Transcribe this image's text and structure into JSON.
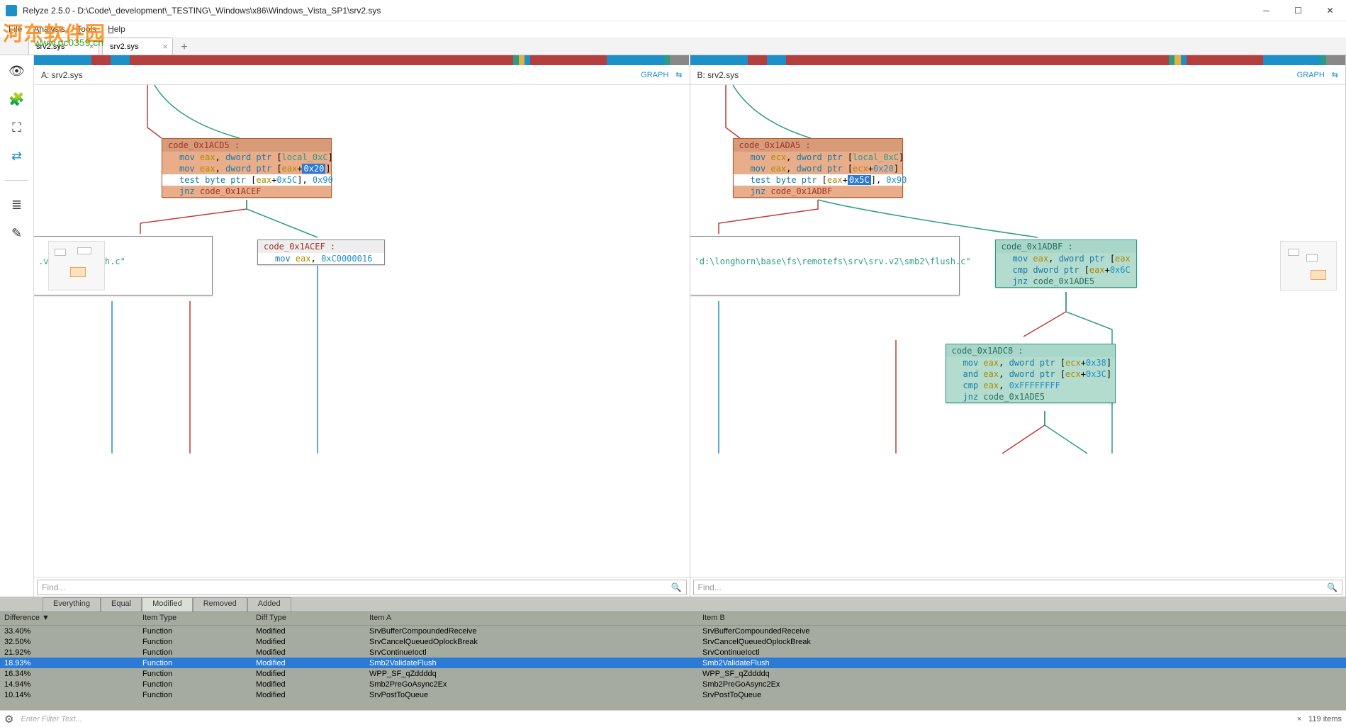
{
  "window": {
    "title": "Relyze 2.5.0 - D:\\Code\\_development\\_TESTING\\_Windows\\x86\\Windows_Vista_SP1\\srv2.sys"
  },
  "watermark": {
    "text": "河东软件园",
    "url": "www.pc0359.cn"
  },
  "menu": {
    "file": "File",
    "analysis": "Analysis",
    "tools": "Tools",
    "help": "Help"
  },
  "file_tabs": {
    "t0": "srv2.sys",
    "t1": "srv2.sys",
    "add": "+"
  },
  "rail": {
    "eye": "eye-icon",
    "puzzle": "puzzle-icon",
    "hierarchy": "hierarchy-icon",
    "shuffle": "shuffle-icon",
    "stack": "stack-icon",
    "edit": "edit-icon"
  },
  "paneA": {
    "label": "A: srv2.sys",
    "view": "GRAPH",
    "find_placeholder": "Find...",
    "node1": {
      "head": "code_0x1ACD5 :",
      "l1a": "mov",
      "l1b": "eax",
      "l1c": "dword ptr",
      "l1d": "local_0xC",
      "l2a": "mov",
      "l2b": "eax",
      "l2c": "dword ptr",
      "l2d": "eax",
      "l2e": "0x20",
      "l3a": "test",
      "l3b": "byte ptr",
      "l3c": "eax",
      "l3d": "0x5C",
      "l3e": "0x90",
      "l4a": "jnz",
      "l4b": "code_0x1ACEF"
    },
    "node2": {
      "head": "code_0x1ACEF :",
      "l1a": "mov",
      "l1b": "eax",
      "l1c": "0xC0000016"
    },
    "node3": {
      "text": ".v2\\smb2\\flush.c\""
    }
  },
  "paneB": {
    "label": "B: srv2.sys",
    "view": "GRAPH",
    "find_placeholder": "Find...",
    "node1": {
      "head": "code_0x1ADA5 :",
      "l1a": "mov",
      "l1b": "ecx",
      "l1c": "dword ptr",
      "l1d": "local_0xC",
      "l2a": "mov",
      "l2b": "eax",
      "l2c": "dword ptr",
      "l2d": "ecx",
      "l2e": "0x20",
      "l3a": "test",
      "l3b": "byte ptr",
      "l3c": "eax",
      "l3d": "0x5C",
      "l3e": "0x90",
      "l4a": "jnz",
      "l4b": "code_0x1ADBF"
    },
    "node2": {
      "head": "code_0x1ADBF :",
      "l1a": "mov",
      "l1b": "eax",
      "l1c": "dword ptr",
      "l1d": "eax",
      "l2a": "cmp",
      "l2b": "dword ptr",
      "l2c": "eax",
      "l2d": "0x6C",
      "l3a": "jnz",
      "l3b": "code_0x1ADE5"
    },
    "node3": {
      "head": "code_0x1ADC8 :",
      "l1a": "mov",
      "l1b": "eax",
      "l1c": "dword ptr",
      "l1d": "ecx",
      "l1e": "0x38",
      "l2a": "and",
      "l2b": "eax",
      "l2c": "dword ptr",
      "l2d": "ecx",
      "l2e": "0x3C",
      "l3a": "cmp",
      "l3b": "eax",
      "l3c": "0xFFFFFFFF",
      "l4a": "jnz",
      "l4b": "code_0x1ADE5"
    },
    "node4": {
      "text": "'d:\\longhorn\\base\\fs\\remotefs\\srv\\srv.v2\\smb2\\flush.c\""
    }
  },
  "diff": {
    "subtabs": {
      "everything": "Everything",
      "equal": "Equal",
      "modified": "Modified",
      "removed": "Removed",
      "added": "Added"
    },
    "headers": {
      "difference": "Difference ▼",
      "itemtype": "Item Type",
      "difftype": "Diff Type",
      "itema": "Item A",
      "itemb": "Item B"
    },
    "rows": [
      {
        "d": "33.40%",
        "t": "Function",
        "dt": "Modified",
        "a": "SrvBufferCompoundedReceive",
        "b": "SrvBufferCompoundedReceive"
      },
      {
        "d": "32.50%",
        "t": "Function",
        "dt": "Modified",
        "a": "SrvCancelQueuedOplockBreak",
        "b": "SrvCancelQueuedOplockBreak"
      },
      {
        "d": "21.92%",
        "t": "Function",
        "dt": "Modified",
        "a": "SrvContinueIoctl",
        "b": "SrvContinueIoctl"
      },
      {
        "d": "18.93%",
        "t": "Function",
        "dt": "Modified",
        "a": "Smb2ValidateFlush",
        "b": "Smb2ValidateFlush"
      },
      {
        "d": "16.34%",
        "t": "Function",
        "dt": "Modified",
        "a": "WPP_SF_qZddddq",
        "b": "WPP_SF_qZddddq"
      },
      {
        "d": "14.94%",
        "t": "Function",
        "dt": "Modified",
        "a": "Smb2PreGoAsync2Ex",
        "b": "Smb2PreGoAsync2Ex"
      },
      {
        "d": "10.14%",
        "t": "Function",
        "dt": "Modified",
        "a": "SrvPostToQueue",
        "b": "SrvPostToQueue"
      }
    ],
    "selected_index": 3
  },
  "status": {
    "filter_placeholder": "Enter Filter Text...",
    "items": "119 items",
    "close": "×"
  }
}
